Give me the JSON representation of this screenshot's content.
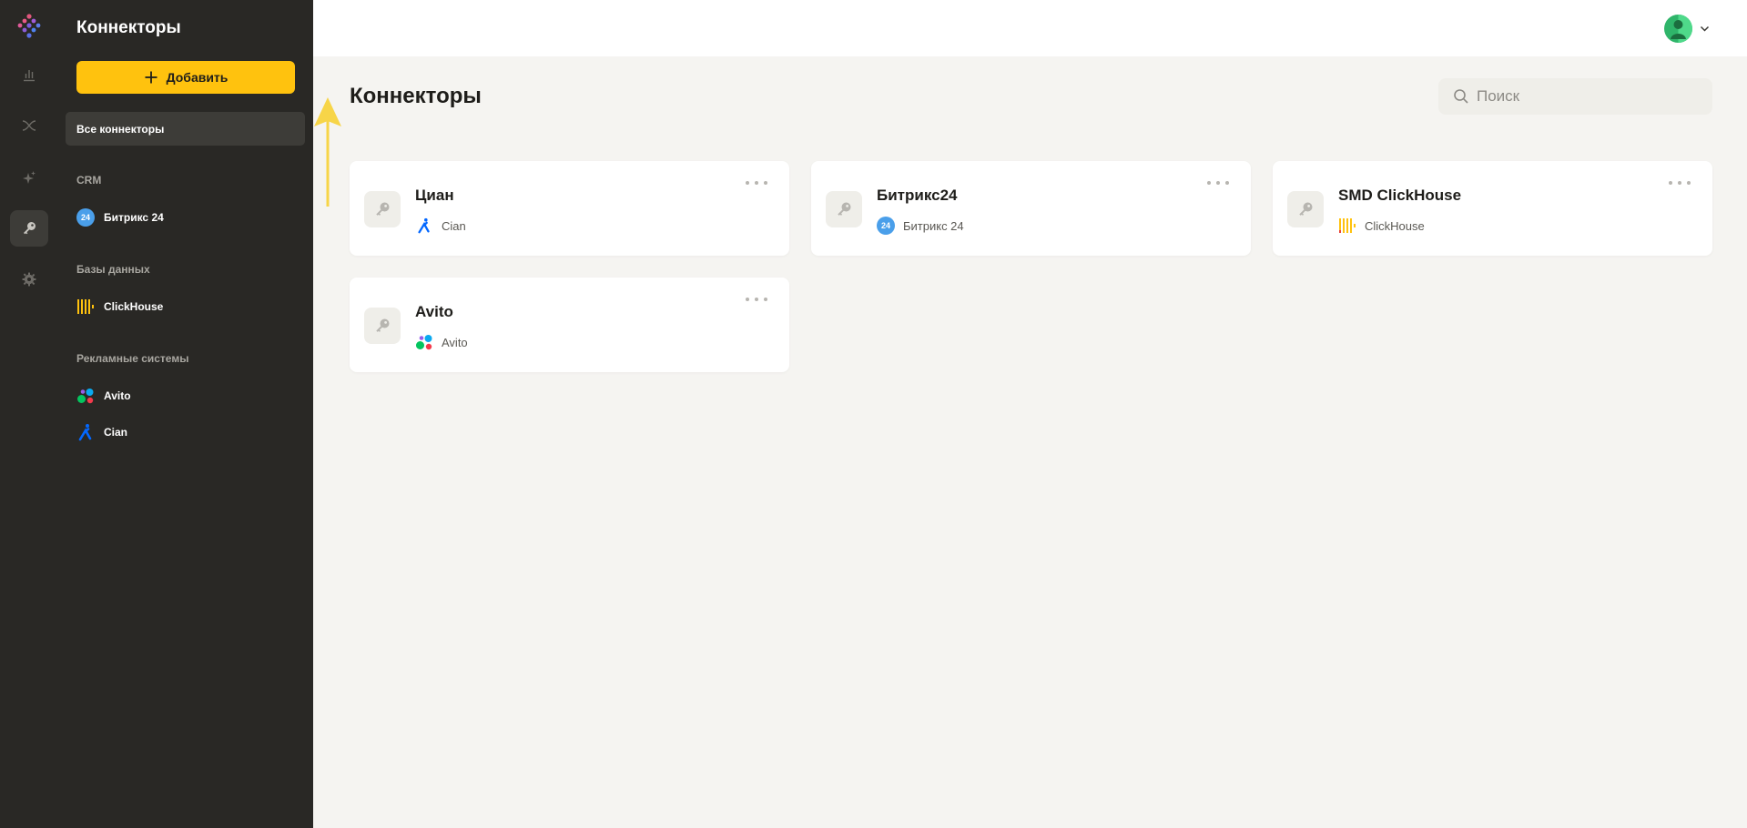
{
  "app": {
    "brand_colors": {
      "accent": "#ffc20e",
      "sidebar_bg": "#292825",
      "page_bg": "#f5f4f1"
    }
  },
  "rail": {
    "items": [
      {
        "icon": "bar-chart-icon"
      },
      {
        "icon": "shuffle-icon"
      },
      {
        "icon": "sparkles-icon"
      },
      {
        "icon": "key-icon",
        "active": true
      },
      {
        "icon": "gear-icon"
      }
    ]
  },
  "sidebar": {
    "title": "Коннекторы",
    "add_label": "Добавить",
    "all_label": "Все коннекторы",
    "sections": [
      {
        "label": "CRM",
        "items": [
          {
            "label": "Битрикс 24",
            "icon": "bitrix24-icon"
          }
        ]
      },
      {
        "label": "Базы данных",
        "items": [
          {
            "label": "ClickHouse",
            "icon": "clickhouse-icon"
          }
        ]
      },
      {
        "label": "Рекламные системы",
        "items": [
          {
            "label": "Avito",
            "icon": "avito-icon"
          },
          {
            "label": "Cian",
            "icon": "cian-icon"
          }
        ]
      }
    ]
  },
  "header": {
    "avatar_icon": "user-avatar",
    "menu_icon": "chevron-down-icon"
  },
  "main": {
    "title": "Коннекторы",
    "search": {
      "placeholder": "Поиск",
      "value": ""
    },
    "connectors": [
      {
        "name": "Циан",
        "source": "Cian",
        "source_icon": "cian-icon"
      },
      {
        "name": "Битрикс24",
        "source": "Битрикс 24",
        "source_icon": "bitrix24-icon"
      },
      {
        "name": "SMD ClickHouse",
        "source": "ClickHouse",
        "source_icon": "clickhouse-icon"
      },
      {
        "name": "Avito",
        "source": "Avito",
        "source_icon": "avito-icon"
      }
    ]
  },
  "badges": {
    "bitrix24": "24"
  }
}
